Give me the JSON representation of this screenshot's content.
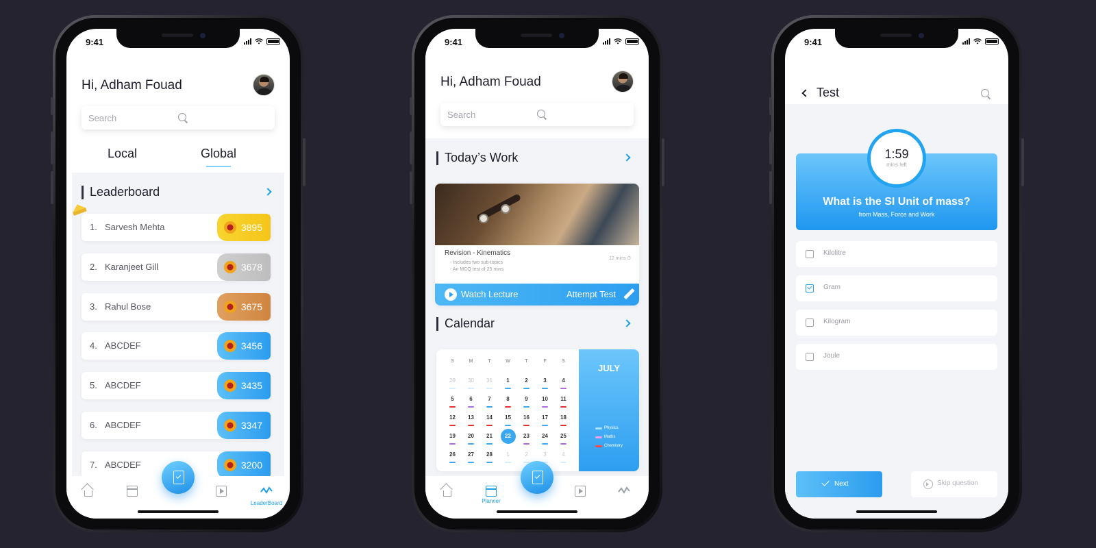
{
  "status_time": "9:41",
  "colors": {
    "accent": "#1e9fe8",
    "gold": "#f5c518",
    "silver": "#c4c4c4",
    "bronze": "#d98e48",
    "blue": "#2d9ef0"
  },
  "leaderboard_screen": {
    "greeting": "Hi,  Adham Fouad",
    "search_placeholder": "Search",
    "tabs": [
      {
        "label": "Local"
      },
      {
        "label": "Global",
        "selected": true
      }
    ],
    "section_title": "Leaderboard",
    "rows": [
      {
        "rank": "1.",
        "name": "Sarvesh Mehta",
        "score": "3895",
        "tier": "gold"
      },
      {
        "rank": "2.",
        "name": "Karanjeet Gill",
        "score": "3678",
        "tier": "silver"
      },
      {
        "rank": "3.",
        "name": "Rahul Bose",
        "score": "3675",
        "tier": "bronze"
      },
      {
        "rank": "4.",
        "name": "ABCDEF",
        "score": "3456",
        "tier": "blue"
      },
      {
        "rank": "5.",
        "name": "ABCDEF",
        "score": "3435",
        "tier": "blue"
      },
      {
        "rank": "6.",
        "name": "ABCDEF",
        "score": "3347",
        "tier": "blue"
      },
      {
        "rank": "7.",
        "name": "ABCDEF",
        "score": "3200",
        "tier": "blue"
      }
    ],
    "nav_active_label": "LeaderBoard"
  },
  "planner_screen": {
    "greeting": "Hi,  Adham Fouad",
    "search_placeholder": "Search",
    "work_title": "Today’s Work",
    "card": {
      "title": "Revision - Kinematics",
      "bullets": [
        "- Includes two sub-topics",
        "- An MCQ test of 25 mins"
      ],
      "duration": "12 mins",
      "watch_label": "Watch Lecture",
      "attempt_label": "Attempt Test"
    },
    "calendar_title": "Calendar",
    "month": "JULY",
    "days_of_week": [
      "S",
      "M",
      "T",
      "W",
      "T",
      "F",
      "S"
    ],
    "weeks": [
      [
        {
          "d": "29",
          "m": true
        },
        {
          "d": "30",
          "m": true
        },
        {
          "d": "31",
          "m": true
        },
        {
          "d": "1",
          "c": "#3aa8f0"
        },
        {
          "d": "2",
          "c": "#3aa8f0"
        },
        {
          "d": "3",
          "c": "#3aa8f0"
        },
        {
          "d": "4",
          "c": "#b06be0"
        }
      ],
      [
        {
          "d": "5",
          "c": "#e03030"
        },
        {
          "d": "6",
          "c": "#b06be0"
        },
        {
          "d": "7",
          "c": "#3aa8f0"
        },
        {
          "d": "8",
          "c": "#e03030"
        },
        {
          "d": "9",
          "c": "#3aa8f0"
        },
        {
          "d": "10",
          "c": "#b06be0"
        },
        {
          "d": "11",
          "c": "#e03030"
        }
      ],
      [
        {
          "d": "12",
          "c": "#e03030"
        },
        {
          "d": "13",
          "c": "#e03030"
        },
        {
          "d": "14",
          "c": "#e03030"
        },
        {
          "d": "15",
          "c": "#3aa8f0"
        },
        {
          "d": "16",
          "c": "#e03030"
        },
        {
          "d": "17",
          "c": "#3aa8f0"
        },
        {
          "d": "18",
          "c": "#e03030"
        }
      ],
      [
        {
          "d": "19",
          "c": "#b06be0"
        },
        {
          "d": "20",
          "c": "#3aa8f0"
        },
        {
          "d": "21",
          "c": "#3aa8f0"
        },
        {
          "d": "22",
          "today": true
        },
        {
          "d": "23",
          "c": "#b06be0"
        },
        {
          "d": "24",
          "c": "#3aa8f0"
        },
        {
          "d": "25",
          "c": "#b06be0"
        }
      ],
      [
        {
          "d": "26",
          "c": "#3aa8f0"
        },
        {
          "d": "27",
          "c": "#3aa8f0"
        },
        {
          "d": "28",
          "c": "#3aa8f0"
        },
        {
          "d": "1",
          "m": true
        },
        {
          "d": "2",
          "m": true
        },
        {
          "d": "3",
          "m": true
        },
        {
          "d": "4",
          "m": true
        }
      ]
    ],
    "legend": [
      {
        "label": "Physics",
        "color": "#a8e0ff"
      },
      {
        "label": "Maths",
        "color": "#f2a0e8"
      },
      {
        "label": "Chemistry",
        "color": "#ff4a4a"
      }
    ],
    "nav_active_label": "Planner"
  },
  "test_screen": {
    "title": "Test",
    "timer": "1:59",
    "timer_caption": "mins left",
    "question": "What is the SI Unit of mass?",
    "question_sub": "from Mass, Force and Work",
    "options": [
      {
        "label": "Kilolitre",
        "checked": false
      },
      {
        "label": "Gram",
        "checked": true
      },
      {
        "label": "Kilogram",
        "checked": false
      },
      {
        "label": "Joule",
        "checked": false
      }
    ],
    "next_label": "Next",
    "skip_label": "Skip question"
  }
}
